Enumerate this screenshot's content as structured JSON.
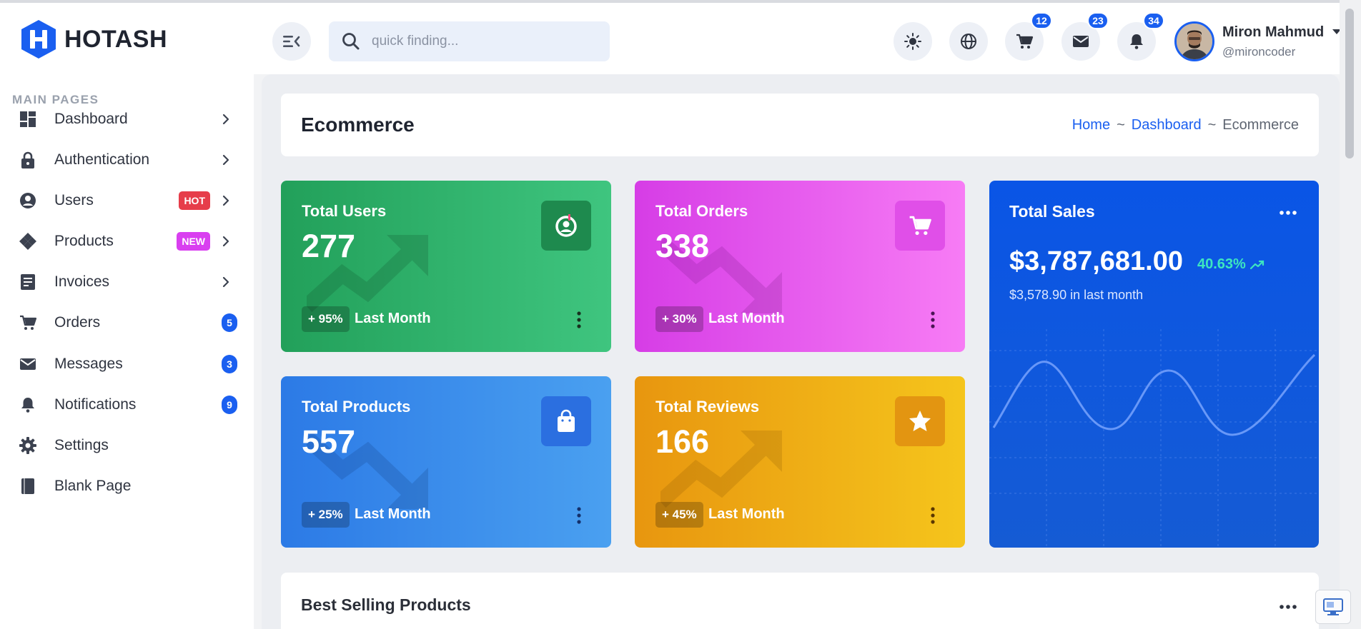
{
  "brand": {
    "name": "HOTASH"
  },
  "search": {
    "placeholder": "quick finding..."
  },
  "header": {
    "cart_count": "12",
    "mail_count": "23",
    "notification_count": "34",
    "user_name": "Miron Mahmud",
    "user_handle": "@mironcoder"
  },
  "sidebar": {
    "heading": "MAIN PAGES",
    "items": [
      {
        "label": "Dashboard",
        "icon": "dashboard-icon"
      },
      {
        "label": "Authentication",
        "icon": "lock-icon"
      },
      {
        "label": "Users",
        "icon": "user-circle-icon",
        "tag": "HOT"
      },
      {
        "label": "Products",
        "icon": "products-icon",
        "tag": "NEW"
      },
      {
        "label": "Invoices",
        "icon": "invoice-icon"
      },
      {
        "label": "Orders",
        "icon": "cart-icon",
        "count": "5"
      },
      {
        "label": "Messages",
        "icon": "mail-icon",
        "count": "3"
      },
      {
        "label": "Notifications",
        "icon": "bell-icon",
        "count": "9"
      },
      {
        "label": "Settings",
        "icon": "gear-icon"
      },
      {
        "label": "Blank Page",
        "icon": "book-icon"
      }
    ]
  },
  "page": {
    "title": "Ecommerce",
    "breadcrumb": [
      "Home",
      "Dashboard",
      "Ecommerce"
    ],
    "separator": "~"
  },
  "stats": [
    {
      "label": "Total Users",
      "value": "277",
      "delta": "+ 95%",
      "period": "Last Month",
      "icon": "user-face-icon"
    },
    {
      "label": "Total Orders",
      "value": "338",
      "delta": "+ 30%",
      "period": "Last Month",
      "icon": "cart-icon"
    },
    {
      "label": "Total Products",
      "value": "557",
      "delta": "+ 25%",
      "period": "Last Month",
      "icon": "shopping-bag-icon"
    },
    {
      "label": "Total Reviews",
      "value": "166",
      "delta": "+ 45%",
      "period": "Last Month",
      "icon": "star-icon"
    }
  ],
  "sales": {
    "title": "Total Sales",
    "value": "$3,787,681.00",
    "growth": "40.63%",
    "last_month": "$3,578.90 in last month"
  },
  "best_selling": {
    "title": "Best Selling Products"
  },
  "colors": {
    "primary": "#1a5ff0",
    "green": "#2bb068",
    "pink": "#e953ee",
    "blue": "#3a8cee",
    "yellow": "#eeaa16",
    "hot": "#e63d4a",
    "new": "#d93ff0",
    "growth": "#3de6c0"
  }
}
